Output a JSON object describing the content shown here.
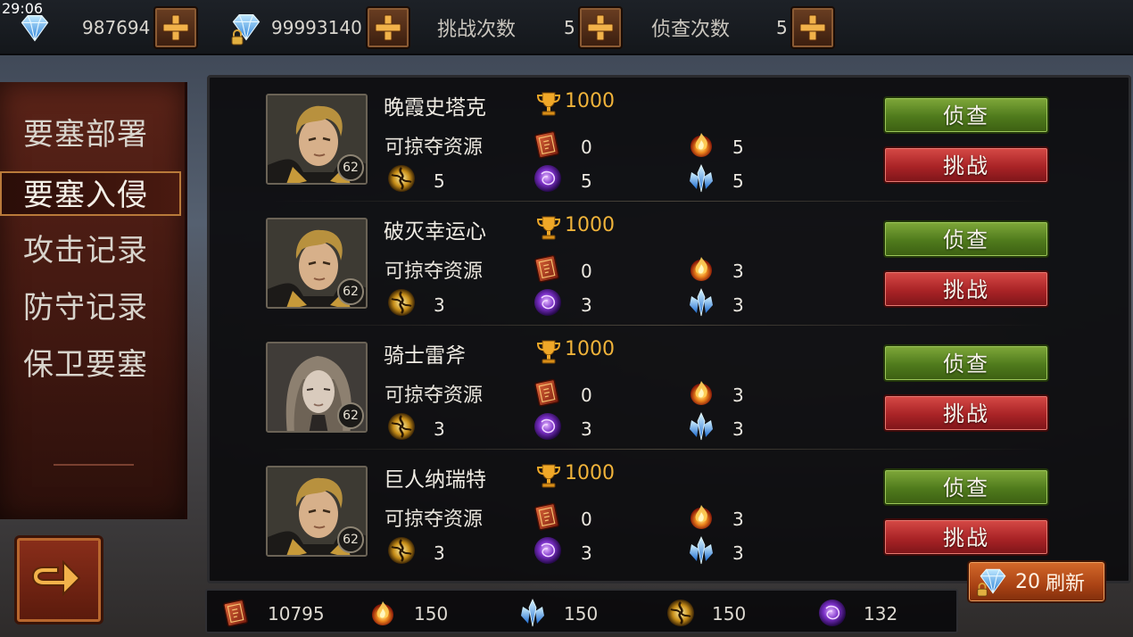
{
  "status_bar": {
    "time": "29:06"
  },
  "top_bar": {
    "currency_1": {
      "icon": "blue-gem-icon",
      "value": "987694"
    },
    "currency_2": {
      "icon": "locked-gem-icon",
      "value": "99993140"
    },
    "challenge_count": {
      "label": "挑战次数",
      "value": "5"
    },
    "scout_count": {
      "label": "侦查次数",
      "value": "5"
    }
  },
  "nav": {
    "items": [
      {
        "label": "要塞部署",
        "active": false
      },
      {
        "label": "要塞入侵",
        "active": true
      },
      {
        "label": "攻击记录",
        "active": false
      },
      {
        "label": "防守记录",
        "active": false
      },
      {
        "label": "保卫要塞",
        "active": false
      }
    ]
  },
  "targets": [
    {
      "name": "晚霞史塔克",
      "level": "62",
      "trophies": "1000",
      "loot_label": "可掠夺资源",
      "book": "0",
      "fire": "5",
      "gold": "5",
      "purple": "5",
      "blue": "5",
      "scout_label": "侦查",
      "fight_label": "挑战",
      "portrait": "blond-knight"
    },
    {
      "name": "破灭幸运心",
      "level": "62",
      "trophies": "1000",
      "loot_label": "可掠夺资源",
      "book": "0",
      "fire": "3",
      "gold": "3",
      "purple": "3",
      "blue": "3",
      "scout_label": "侦查",
      "fight_label": "挑战",
      "portrait": "blond-knight"
    },
    {
      "name": "骑士雷斧",
      "level": "62",
      "trophies": "1000",
      "loot_label": "可掠夺资源",
      "book": "0",
      "fire": "3",
      "gold": "3",
      "purple": "3",
      "blue": "3",
      "scout_label": "侦查",
      "fight_label": "挑战",
      "portrait": "long-hair-knight"
    },
    {
      "name": "巨人纳瑞特",
      "level": "62",
      "trophies": "1000",
      "loot_label": "可掠夺资源",
      "book": "0",
      "fire": "3",
      "gold": "3",
      "purple": "3",
      "blue": "3",
      "scout_label": "侦查",
      "fight_label": "挑战",
      "portrait": "blond-knight"
    }
  ],
  "refresh": {
    "cost": "20",
    "label": "刷新"
  },
  "resources": {
    "book": "10795",
    "fire": "150",
    "blue": "150",
    "gold": "150",
    "purple": "132"
  },
  "colors": {
    "accent_gold": "#f0b33a",
    "scout_green": "#4f7a1c",
    "fight_red": "#a92326",
    "refresh_orange": "#a94214"
  }
}
